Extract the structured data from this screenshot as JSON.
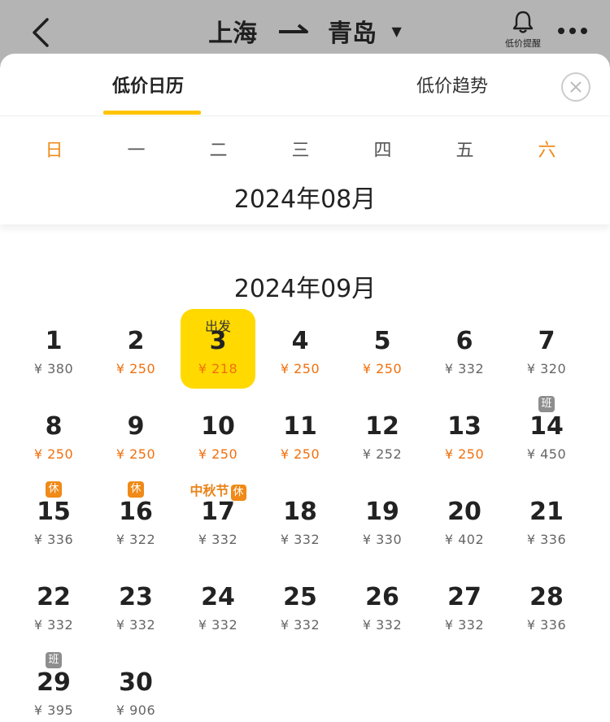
{
  "header": {
    "origin": "上海",
    "destination": "青岛",
    "alert_label": "低价提醒"
  },
  "tabs": [
    {
      "label": "低价日历",
      "active": true
    },
    {
      "label": "低价趋势",
      "active": false
    }
  ],
  "weekdays": [
    "日",
    "一",
    "二",
    "三",
    "四",
    "五",
    "六"
  ],
  "sticky_month": "2024年08月",
  "month": {
    "title": "2024年09月",
    "start_weekday": 0,
    "currency": "¥",
    "days": [
      {
        "day": "1",
        "price": "380",
        "low": false
      },
      {
        "day": "2",
        "price": "250",
        "low": true
      },
      {
        "day": "3",
        "price": "218",
        "low": true,
        "selected": true,
        "tag": "出发"
      },
      {
        "day": "4",
        "price": "250",
        "low": true
      },
      {
        "day": "5",
        "price": "250",
        "low": true
      },
      {
        "day": "6",
        "price": "332",
        "low": false
      },
      {
        "day": "7",
        "price": "320",
        "low": false
      },
      {
        "day": "8",
        "price": "250",
        "low": true
      },
      {
        "day": "9",
        "price": "250",
        "low": true
      },
      {
        "day": "10",
        "price": "250",
        "low": true
      },
      {
        "day": "11",
        "price": "250",
        "low": true
      },
      {
        "day": "12",
        "price": "252",
        "low": false
      },
      {
        "day": "13",
        "price": "250",
        "low": true
      },
      {
        "day": "14",
        "price": "450",
        "low": false,
        "badge": "班",
        "badge_type": "work"
      },
      {
        "day": "15",
        "price": "336",
        "low": false,
        "badge": "休",
        "badge_type": "rest"
      },
      {
        "day": "16",
        "price": "322",
        "low": false,
        "badge": "休",
        "badge_type": "rest"
      },
      {
        "day": "17",
        "price": "332",
        "low": false,
        "holiday": "中秋节",
        "badge": "休",
        "badge_type": "rest"
      },
      {
        "day": "18",
        "price": "332",
        "low": false
      },
      {
        "day": "19",
        "price": "330",
        "low": false
      },
      {
        "day": "20",
        "price": "402",
        "low": false
      },
      {
        "day": "21",
        "price": "336",
        "low": false
      },
      {
        "day": "22",
        "price": "332",
        "low": false
      },
      {
        "day": "23",
        "price": "332",
        "low": false
      },
      {
        "day": "24",
        "price": "332",
        "low": false
      },
      {
        "day": "25",
        "price": "332",
        "low": false
      },
      {
        "day": "26",
        "price": "332",
        "low": false
      },
      {
        "day": "27",
        "price": "332",
        "low": false
      },
      {
        "day": "28",
        "price": "336",
        "low": false
      },
      {
        "day": "29",
        "price": "395",
        "low": false,
        "badge": "班",
        "badge_type": "work"
      },
      {
        "day": "30",
        "price": "906",
        "low": false
      }
    ]
  },
  "colors": {
    "accent": "#ffd900",
    "low_price": "#f0700f",
    "weekend": "#f08a18"
  },
  "icons": [
    "back-icon",
    "route-arrow-icon",
    "dropdown-caret-icon",
    "bell-icon",
    "more-icon",
    "close-icon"
  ]
}
